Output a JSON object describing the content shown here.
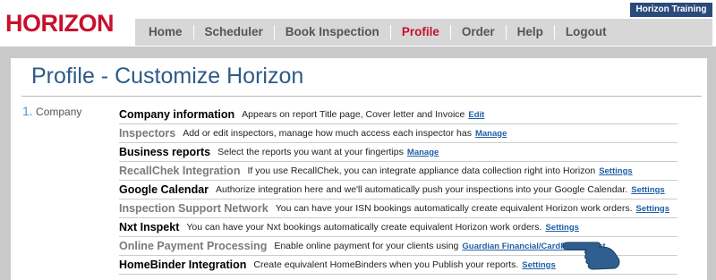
{
  "brand": {
    "logo": "HORIZON",
    "badge": "Horizon Training"
  },
  "nav": {
    "items": [
      {
        "label": "Home",
        "active": false
      },
      {
        "label": "Scheduler",
        "active": false
      },
      {
        "label": "Book Inspection",
        "active": false
      },
      {
        "label": "Profile",
        "active": true
      },
      {
        "label": "Order",
        "active": false
      },
      {
        "label": "Help",
        "active": false
      },
      {
        "label": "Logout",
        "active": false
      }
    ]
  },
  "page": {
    "title": "Profile - Customize Horizon",
    "step_number": "1.",
    "step_label": "Company"
  },
  "rows": [
    {
      "title": "Company information",
      "enabled": true,
      "desc": "Appears on report Title page, Cover letter and Invoice",
      "link": "Edit"
    },
    {
      "title": "Inspectors",
      "enabled": false,
      "desc": "Add or edit inspectors, manage how much access each inspector has",
      "link": "Manage"
    },
    {
      "title": "Business reports",
      "enabled": true,
      "desc": "Select the reports you want at your fingertips",
      "link": "Manage"
    },
    {
      "title": "RecallChek Integration",
      "enabled": false,
      "desc": "If you use RecallChek, you can integrate appliance data collection right into Horizon",
      "link": "Settings"
    },
    {
      "title": "Google Calendar",
      "enabled": true,
      "desc": "Authorize integration here and we'll automatically push your inspections into your Google Calendar.",
      "link": "Settings"
    },
    {
      "title": "Inspection Support Network",
      "enabled": false,
      "desc": "You can have your ISN bookings automatically create equivalent Horizon work orders.",
      "link": "Settings"
    },
    {
      "title": "Nxt Inspekt",
      "enabled": true,
      "desc": "You can have your Nxt bookings automatically create equivalent Horizon work orders.",
      "link": "Settings"
    },
    {
      "title": "Online Payment Processing",
      "enabled": false,
      "desc": "Enable online payment for your clients using",
      "link": "Guardian Financial/CardPointe",
      "link2": "Net"
    },
    {
      "title": "HomeBinder Integration",
      "enabled": true,
      "desc": "Create equivalent HomeBinders when you Publish your reports.",
      "link": "Settings"
    }
  ],
  "colors": {
    "brand_red": "#c8102e",
    "nav_bg": "#d7d7d7",
    "badge_bg": "#2b4a7c",
    "title_blue": "#2e5a8a",
    "link_blue": "#1f5fa8",
    "hand_blue": "#2e5f8f"
  },
  "icons": {
    "pointer": "pointing-hand-icon"
  }
}
